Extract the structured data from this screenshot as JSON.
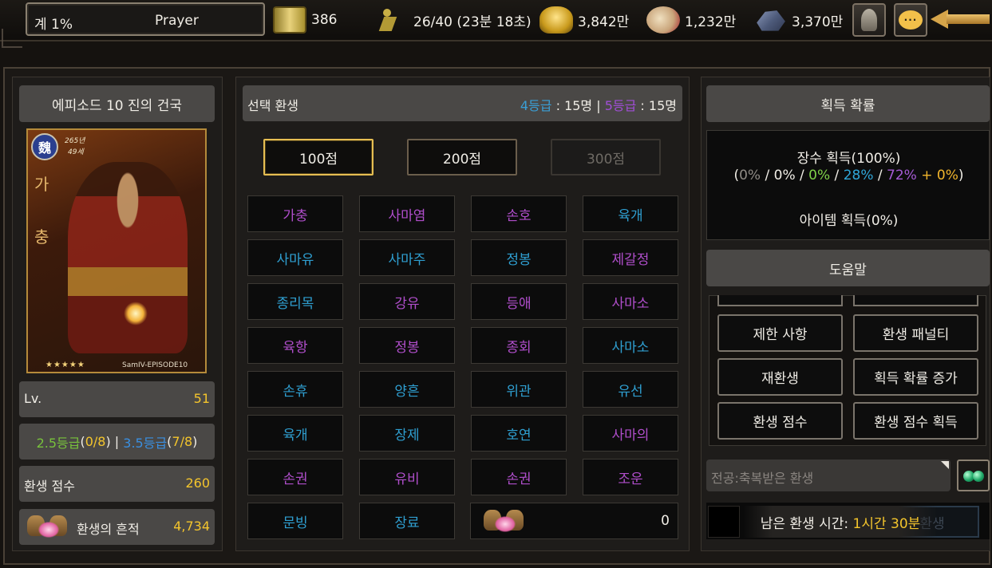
{
  "status": {
    "percent": "계 1%",
    "name": "Prayer"
  },
  "resources": [
    {
      "icon": "scroll-icon",
      "value": "386"
    },
    {
      "icon": "runner-icon",
      "value": "26/40 (23분 18초)"
    },
    {
      "icon": "gold-icon",
      "value": "3,842만"
    },
    {
      "icon": "food-icon",
      "value": "1,232만"
    },
    {
      "icon": "iron-icon",
      "value": "3,370만"
    }
  ],
  "left": {
    "episode_title": "에피소드 10 진의 건국",
    "card": {
      "kingdom": "魏",
      "years": "265년",
      "age": "49세",
      "vchars": [
        "가",
        "충"
      ],
      "stars": "★★★★★",
      "tag": "SamIV-EPISODE10"
    },
    "level_label": "Lv.",
    "level_value": "51",
    "grade_a": "2.5등급",
    "grade_a_open": "(",
    "grade_a_count": "0/8",
    "grade_a_close": ")",
    "grade_sep": " | ",
    "grade_b": "3.5등급",
    "grade_b_open": "(",
    "grade_b_count": "7/8",
    "grade_b_close": ")",
    "score_label": "환생 점수",
    "score_value": "260",
    "trace_label": "환생의 흔적",
    "trace_value": "4,734"
  },
  "center": {
    "title": "선택 환생",
    "g4_label": "4등급",
    "g4_count": " : 15명 | ",
    "g5_label": "5등급",
    "g5_count": " : 15명",
    "point_buttons": [
      "100점",
      "200점",
      "300점"
    ],
    "generals": [
      {
        "name": "가충",
        "tier": "p"
      },
      {
        "name": "사마염",
        "tier": "p"
      },
      {
        "name": "손호",
        "tier": "p"
      },
      {
        "name": "육개",
        "tier": "b"
      },
      {
        "name": "사마유",
        "tier": "b"
      },
      {
        "name": "사마주",
        "tier": "b"
      },
      {
        "name": "정봉",
        "tier": "b"
      },
      {
        "name": "제갈정",
        "tier": "p"
      },
      {
        "name": "종리목",
        "tier": "b"
      },
      {
        "name": "강유",
        "tier": "p"
      },
      {
        "name": "등애",
        "tier": "p"
      },
      {
        "name": "사마소",
        "tier": "p"
      },
      {
        "name": "육항",
        "tier": "p"
      },
      {
        "name": "정봉",
        "tier": "p"
      },
      {
        "name": "종회",
        "tier": "p"
      },
      {
        "name": "사마소",
        "tier": "b"
      },
      {
        "name": "손휴",
        "tier": "b"
      },
      {
        "name": "양흔",
        "tier": "b"
      },
      {
        "name": "위관",
        "tier": "b"
      },
      {
        "name": "유선",
        "tier": "b"
      },
      {
        "name": "육개",
        "tier": "b"
      },
      {
        "name": "장제",
        "tier": "b"
      },
      {
        "name": "호연",
        "tier": "b"
      },
      {
        "name": "사마의",
        "tier": "p"
      },
      {
        "name": "손권",
        "tier": "p"
      },
      {
        "name": "유비",
        "tier": "p"
      },
      {
        "name": "손권",
        "tier": "p"
      },
      {
        "name": "조운",
        "tier": "p"
      },
      {
        "name": "문빙",
        "tier": "b"
      },
      {
        "name": "장료",
        "tier": "b"
      }
    ],
    "trace_cost": "0"
  },
  "right": {
    "acq_title": "획득 확률",
    "general_acq": "장수 획득(100%)",
    "rates": {
      "open": "(",
      "r1": "0%",
      "s1": " / ",
      "r2": "0%",
      "s2": " / ",
      "r3": "0%",
      "s3": " / ",
      "r4": "28%",
      "s4": " / ",
      "r5": "72%",
      "s5": " + ",
      "r6": "0%",
      "close": ")"
    },
    "item_acq": "아이템 획득(0%)",
    "help_title": "도움말",
    "help_buttons": [
      "제한 사항",
      "환생 패널티",
      "재환생",
      "획득 확률 증가",
      "환생 점수",
      "환생 점수 획득"
    ],
    "chat_placeholder": "전공:축복받은 환생",
    "timer_label": "남은 환생 시간: ",
    "timer_value": "1시간 30분",
    "ghost_button": "환생"
  },
  "colors": {
    "grade_purple": "#b04ecb",
    "grade_blue": "#2f9fd1",
    "highlight_gold": "#f4c52c"
  }
}
